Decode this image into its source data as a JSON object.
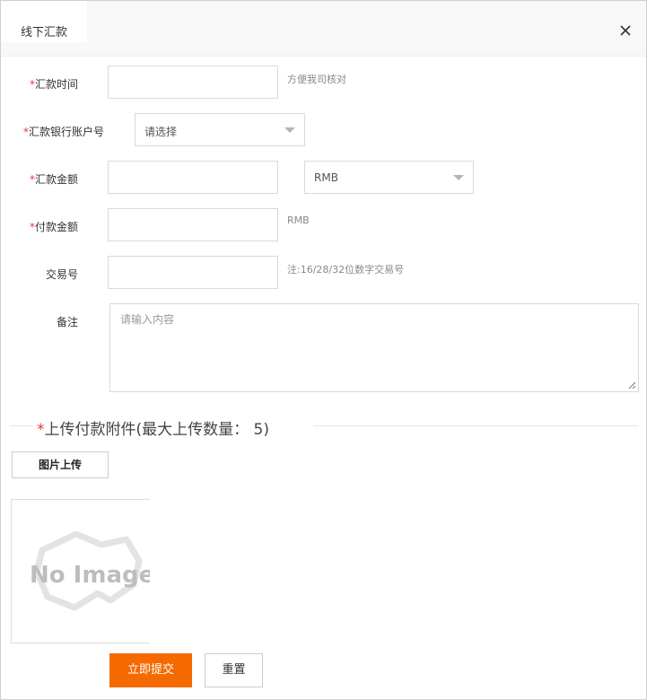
{
  "dialog": {
    "title": "线下汇款",
    "close_icon": "close-icon"
  },
  "form": {
    "remit_time": {
      "label": "汇款时间",
      "required": "*",
      "value": "",
      "hint": "方便我司核对"
    },
    "remit_account": {
      "label": "汇款银行账户号",
      "required": "*",
      "selected": "请选择"
    },
    "remit_amount": {
      "label": "汇款金额",
      "required": "*",
      "value": "",
      "currency": "RMB"
    },
    "pay_amount": {
      "label": "付款金额",
      "required": "*",
      "value": "",
      "hint": "RMB"
    },
    "trade_no": {
      "label": "交易号",
      "value": "",
      "hint": "注:16/28/32位数字交易号"
    },
    "remark": {
      "label": "备注",
      "placeholder": "请输入内容"
    }
  },
  "attachments": {
    "required": "*",
    "title": "上传付款附件(最大上传数量： 5)",
    "upload_button": "图片上传",
    "placeholder_image_text": "No Image"
  },
  "actions": {
    "submit": "立即提交",
    "reset": "重置"
  },
  "colors": {
    "primary": "#f56a00",
    "required": "#e4393c"
  }
}
